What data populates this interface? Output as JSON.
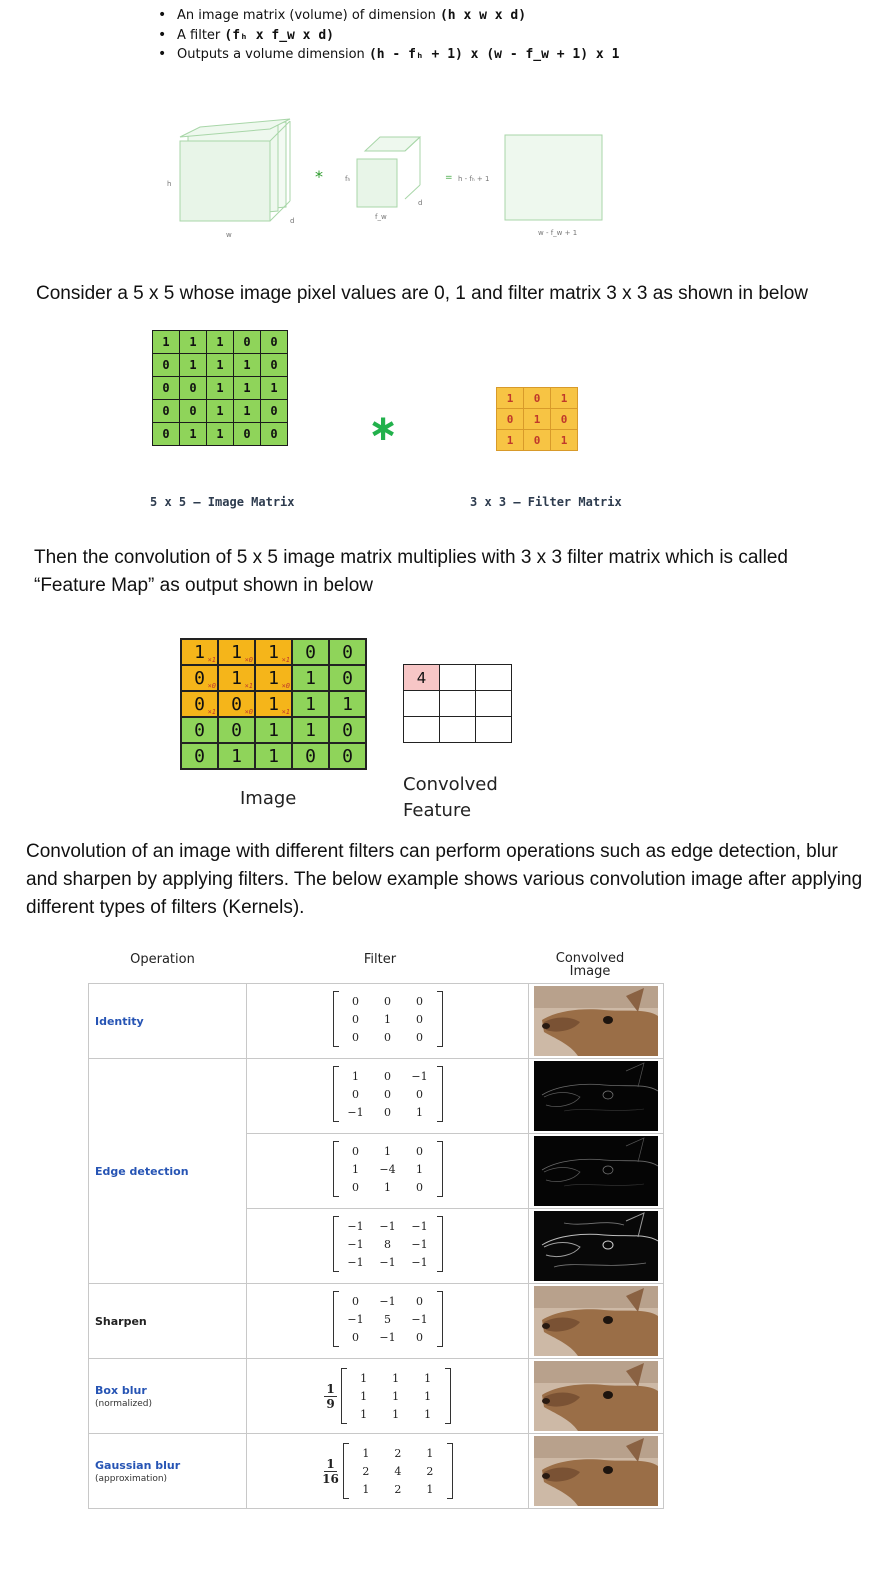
{
  "bullets": [
    {
      "text": "An image matrix (volume) of dimension ",
      "bold": "(h x w x d)"
    },
    {
      "text": "A filter ",
      "bold": "(fₕ x f_w x d)"
    },
    {
      "text": "Outputs a volume dimension ",
      "bold": "(h - fₕ + 1) x (w - f_w + 1) x 1"
    }
  ],
  "diagram": {
    "h": "h",
    "w": "w",
    "d1": "d",
    "op": "*",
    "fh": "fₕ",
    "fw": "f_w",
    "d2": "d",
    "eq": "=",
    "out_h": "h - fₕ + 1",
    "out_w": "w - f_w + 1"
  },
  "para1": "Consider a 5 x 5 whose image pixel values are 0, 1 and filter matrix 3 x 3 as shown in below",
  "image_matrix": [
    [
      1,
      1,
      1,
      0,
      0
    ],
    [
      0,
      1,
      1,
      1,
      0
    ],
    [
      0,
      0,
      1,
      1,
      1
    ],
    [
      0,
      0,
      1,
      1,
      0
    ],
    [
      0,
      1,
      1,
      0,
      0
    ]
  ],
  "filter_matrix": [
    [
      1,
      0,
      1
    ],
    [
      0,
      1,
      0
    ],
    [
      1,
      0,
      1
    ]
  ],
  "asterisk": "∗",
  "image_matrix_caption": "5 x 5 – Image Matrix",
  "filter_matrix_caption": "3 x 3 – Filter Matrix",
  "para2": "Then the convolution of 5 x 5 image matrix multiplies with 3 x 3 filter matrix which is called “Feature Map” as output shown in below",
  "conv_image": [
    [
      1,
      1,
      1,
      0,
      0
    ],
    [
      0,
      1,
      1,
      1,
      0
    ],
    [
      0,
      0,
      1,
      1,
      1
    ],
    [
      0,
      0,
      1,
      1,
      0
    ],
    [
      0,
      1,
      1,
      0,
      0
    ]
  ],
  "conv_weights": [
    "×1",
    "×0",
    "×1",
    "×0",
    "×1",
    "×0",
    "×1",
    "×0",
    "×1"
  ],
  "conv_feature": [
    [
      "4",
      "",
      ""
    ],
    [
      "",
      "",
      ""
    ],
    [
      "",
      "",
      ""
    ]
  ],
  "image_caption": "Image",
  "feature_caption_line1": "Convolved",
  "feature_caption_line2": "Feature",
  "para3": "Convolution of an image with different filters can perform operations such as edge detection, blur and sharpen by applying filters. The below example shows various convolution image after applying different types of filters (Kernels).",
  "kernels": {
    "headers": {
      "operation": "Operation",
      "filter": "Filter",
      "image_line1": "Convolved",
      "image_line2": "Image"
    },
    "rows": [
      {
        "op": "Identity",
        "sub": "",
        "kernel": [
          [
            "0",
            "0",
            "0"
          ],
          [
            "0",
            "1",
            "0"
          ],
          [
            "0",
            "0",
            "0"
          ]
        ],
        "scale": null
      },
      {
        "op": "",
        "sub": "",
        "kernel": [
          [
            "1",
            "0",
            "−1"
          ],
          [
            "0",
            "0",
            "0"
          ],
          [
            "−1",
            "0",
            "1"
          ]
        ],
        "scale": null
      },
      {
        "op": "Edge detection",
        "sub": "",
        "kernel": [
          [
            "0",
            "1",
            "0"
          ],
          [
            "1",
            "−4",
            "1"
          ],
          [
            "0",
            "1",
            "0"
          ]
        ],
        "scale": null
      },
      {
        "op": "",
        "sub": "",
        "kernel": [
          [
            "−1",
            "−1",
            "−1"
          ],
          [
            "−1",
            "8",
            "−1"
          ],
          [
            "−1",
            "−1",
            "−1"
          ]
        ],
        "scale": null
      },
      {
        "op": "Sharpen",
        "sub": "",
        "kernel": [
          [
            "0",
            "−1",
            "0"
          ],
          [
            "−1",
            "5",
            "−1"
          ],
          [
            "0",
            "−1",
            "0"
          ]
        ],
        "scale": null
      },
      {
        "op": "Box blur",
        "sub": "(normalized)",
        "kernel": [
          [
            "1",
            "1",
            "1"
          ],
          [
            "1",
            "1",
            "1"
          ],
          [
            "1",
            "1",
            "1"
          ]
        ],
        "scale": [
          "1",
          "9"
        ]
      },
      {
        "op": "Gaussian blur",
        "sub": "(approximation)",
        "kernel": [
          [
            "1",
            "2",
            "1"
          ],
          [
            "2",
            "4",
            "2"
          ],
          [
            "1",
            "2",
            "1"
          ]
        ],
        "scale": [
          "1",
          "16"
        ]
      }
    ]
  },
  "colors": {
    "green": "#8fd45a",
    "orange": "#f7c444",
    "yellow": "#f5b51a",
    "link": "#2654b4",
    "pink": "#f7c6c6"
  }
}
